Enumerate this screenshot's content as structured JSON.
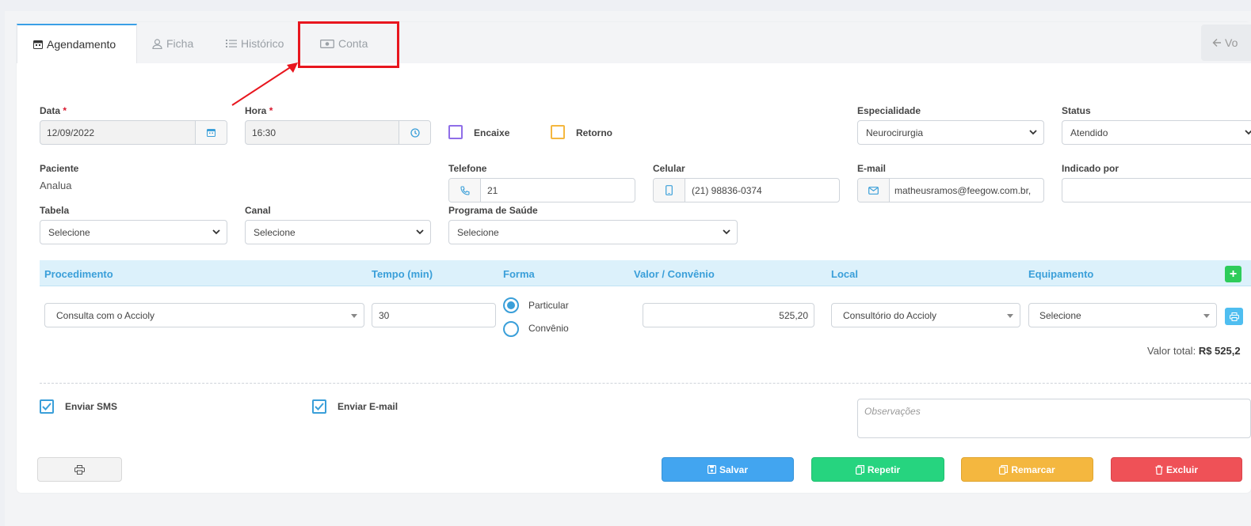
{
  "tabs": [
    {
      "label": "Agendamento",
      "icon": "calendar-icon",
      "active": true
    },
    {
      "label": "Ficha",
      "icon": "user-icon",
      "active": false
    },
    {
      "label": "Histórico",
      "icon": "list-icon",
      "active": false
    },
    {
      "label": "Conta",
      "icon": "money-icon",
      "active": false
    }
  ],
  "back_button": "Vo",
  "form": {
    "data_label": "Data",
    "data_value": "12/09/2022",
    "hora_label": "Hora",
    "hora_value": "16:30",
    "required_mark": "*",
    "encaixe_label": "Encaixe",
    "retorno_label": "Retorno",
    "especialidade_label": "Especialidade",
    "especialidade_value": "Neurocirurgia",
    "status_label": "Status",
    "status_value": "Atendido",
    "paciente_label": "Paciente",
    "paciente_value": "Analua",
    "telefone_label": "Telefone",
    "telefone_value": "21",
    "celular_label": "Celular",
    "celular_value": "(21) 98836-0374",
    "email_label": "E-mail",
    "email_value": "matheusramos@feegow.com.br,",
    "indicado_label": "Indicado por",
    "indicado_value": "",
    "tabela_label": "Tabela",
    "tabela_value": "Selecione",
    "canal_label": "Canal",
    "canal_value": "Selecione",
    "programa_label": "Programa de Saúde",
    "programa_value": "Selecione"
  },
  "procedures": {
    "headers": [
      "Procedimento",
      "Tempo (min)",
      "Forma",
      "Valor / Convênio",
      "Local",
      "Equipamento"
    ],
    "add_label": "+",
    "row": {
      "procedimento": "Consulta com o Accioly",
      "tempo": "30",
      "forma_options": [
        "Particular",
        "Convênio"
      ],
      "forma_selected": "Particular",
      "valor": "525,20",
      "local": "Consultório do Accioly",
      "equipamento": "Selecione"
    },
    "valor_total_label": "Valor total:",
    "valor_total_value": "R$ 525,2"
  },
  "notifications": {
    "sms_label": "Enviar SMS",
    "sms_checked": true,
    "email_label": "Enviar E-mail",
    "email_checked": true,
    "observacoes_placeholder": "Observações"
  },
  "actions": {
    "salvar": "Salvar",
    "repetir": "Repetir",
    "remarcar": "Remarcar",
    "excluir": "Excluir"
  },
  "colors": {
    "primary": "#42a5f0",
    "success": "#26d47f",
    "warning": "#f4b73f",
    "danger": "#ef5157",
    "highlight": "#e8161e"
  }
}
